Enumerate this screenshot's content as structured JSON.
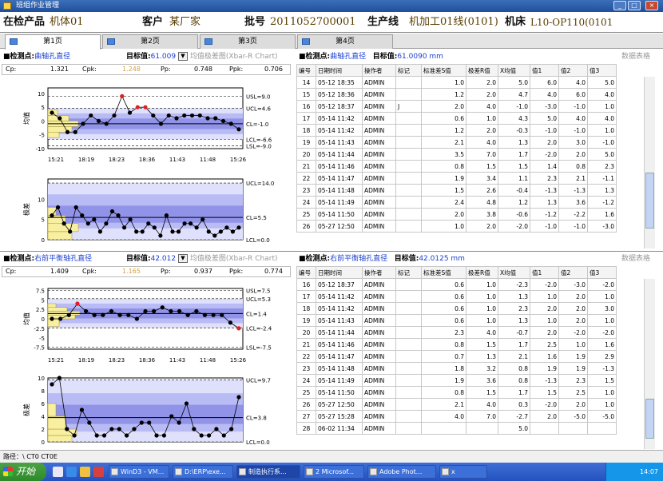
{
  "window": {
    "title": "班组作业管理"
  },
  "info": {
    "product_label": "在检产品",
    "product_value": "机体01",
    "customer_label": "客户",
    "customer_value": "某厂家",
    "batch_label": "批号",
    "batch_value": "2011052700001",
    "line_label": "生产线",
    "line_value": "机加工01线(0101)",
    "machine_label": "机床",
    "machine_value": "L10-OP110(0101"
  },
  "tabs": [
    "第1页",
    "第2页",
    "第3页",
    "第4页"
  ],
  "panel1": {
    "point_label": "■检测点:",
    "point_name": "曲轴孔直径",
    "target_label": "目标值:",
    "target_value": "61.009",
    "chart_sel": "均值极差图(Xbar-R Chart)",
    "right_point_name": "曲轴孔直径",
    "right_target": "61.0090 mm",
    "link": "数据表格",
    "cap": {
      "cp_label": "Cp:",
      "cp": "1.321",
      "cpk_label": "Cpk:",
      "cpk": "1.248",
      "pp_label": "Pp:",
      "pp": "0.748",
      "ppk_label": "Ppk:",
      "ppk": "0.706"
    },
    "xbar_ylabel": "均值",
    "r_ylabel": "极差",
    "xbar_labels": [
      "USL=9.0",
      "UCL=4.6",
      "CL=-1.0",
      "LCL=-6.6",
      "LSL=-9.0"
    ],
    "r_labels": [
      "UCL=14.0",
      "CL=5.5",
      "LCL=0.0"
    ],
    "xticks": [
      "15:21",
      "18:19",
      "18:23",
      "18:36",
      "11:43",
      "11:48",
      "15:26"
    ],
    "xbar_yticks": [
      "10",
      "5",
      "0",
      "-5",
      "-10"
    ],
    "r_yticks": [
      "10",
      "5",
      "0"
    ]
  },
  "panel2": {
    "point_label": "■检测点:",
    "point_name": "右前平衡轴孔直径",
    "target_label": "目标值:",
    "target_value": "42.012",
    "chart_sel": "均值极差图(Xbar-R Chart)",
    "right_point_name": "右前平衡轴孔直径",
    "right_target": "42.0125 mm",
    "link": "数据表格",
    "cap": {
      "cp_label": "Cp:",
      "cp": "1.409",
      "cpk_label": "Cpk:",
      "cpk": "1.165",
      "pp_label": "Pp:",
      "pp": "0.937",
      "ppk_label": "Ppk:",
      "ppk": "0.774"
    },
    "xbar_ylabel": "均值",
    "r_ylabel": "极差",
    "xbar_labels": [
      "USL=7.5",
      "UCL=5.3",
      "CL=1.4",
      "LCL=-2.4",
      "LSL=-7.5"
    ],
    "r_labels": [
      "UCL=9.7",
      "CL=3.8",
      "LCL=0.0"
    ],
    "xticks": [
      "15:21",
      "18:19",
      "18:23",
      "18:36",
      "11:43",
      "11:48",
      "15:26"
    ],
    "xbar_yticks": [
      "7.5",
      "5",
      "2.5",
      "0",
      "-2.5",
      "-5",
      "-7.5"
    ],
    "r_yticks": [
      "10",
      "8",
      "6",
      "4",
      "2",
      "0"
    ]
  },
  "table_headers": [
    "编号",
    "日期时间",
    "操作者",
    "标记",
    "标准差S值",
    "极差R值",
    "X均值",
    "值1",
    "值2",
    "值3"
  ],
  "table1": [
    [
      "14",
      "05-12 18:35",
      "ADMIN",
      "",
      "1.0",
      "2.0",
      "5.0",
      "6.0",
      "4.0",
      "5.0"
    ],
    [
      "15",
      "05-12 18:36",
      "ADMIN",
      "",
      "1.2",
      "2.0",
      "4.7",
      "4.0",
      "6.0",
      "4.0"
    ],
    [
      "16",
      "05-12 18:37",
      "ADMIN",
      "J",
      "2.0",
      "4.0",
      "-1.0",
      "-3.0",
      "-1.0",
      "1.0"
    ],
    [
      "17",
      "05-14 11:42",
      "ADMIN",
      "",
      "0.6",
      "1.0",
      "4.3",
      "5.0",
      "4.0",
      "4.0"
    ],
    [
      "18",
      "05-14 11:42",
      "ADMIN",
      "",
      "1.2",
      "2.0",
      "-0.3",
      "-1.0",
      "-1.0",
      "1.0"
    ],
    [
      "19",
      "05-14 11:43",
      "ADMIN",
      "",
      "2.1",
      "4.0",
      "1.3",
      "2.0",
      "3.0",
      "-1.0"
    ],
    [
      "20",
      "05-14 11:44",
      "ADMIN",
      "",
      "3.5",
      "7.0",
      "1.7",
      "-2.0",
      "2.0",
      "5.0"
    ],
    [
      "21",
      "05-14 11:46",
      "ADMIN",
      "",
      "0.8",
      "1.5",
      "1.5",
      "1.4",
      "0.8",
      "2.3"
    ],
    [
      "22",
      "05-14 11:47",
      "ADMIN",
      "",
      "1.9",
      "3.4",
      "1.1",
      "2.3",
      "2.1",
      "-1.1"
    ],
    [
      "23",
      "05-14 11:48",
      "ADMIN",
      "",
      "1.5",
      "2.6",
      "-0.4",
      "-1.3",
      "-1.3",
      "1.3"
    ],
    [
      "24",
      "05-14 11:49",
      "ADMIN",
      "",
      "2.4",
      "4.8",
      "1.2",
      "1.3",
      "3.6",
      "-1.2"
    ],
    [
      "25",
      "05-14 11:50",
      "ADMIN",
      "",
      "2.0",
      "3.8",
      "-0.6",
      "-1.2",
      "-2.2",
      "1.6"
    ],
    [
      "26",
      "05-27 12:50",
      "ADMIN",
      "",
      "1.0",
      "2.0",
      "-2.0",
      "-1.0",
      "-1.0",
      "-3.0"
    ]
  ],
  "table2": [
    [
      "16",
      "05-12 18:37",
      "ADMIN",
      "",
      "0.6",
      "1.0",
      "-2.3",
      "-2.0",
      "-3.0",
      "-2.0"
    ],
    [
      "17",
      "05-14 11:42",
      "ADMIN",
      "",
      "0.6",
      "1.0",
      "1.3",
      "1.0",
      "2.0",
      "1.0"
    ],
    [
      "18",
      "05-14 11:42",
      "ADMIN",
      "",
      "0.6",
      "1.0",
      "2.3",
      "2.0",
      "2.0",
      "3.0"
    ],
    [
      "19",
      "05-14 11:43",
      "ADMIN",
      "",
      "0.6",
      "1.0",
      "1.3",
      "1.0",
      "2.0",
      "1.0"
    ],
    [
      "20",
      "05-14 11:44",
      "ADMIN",
      "",
      "2.3",
      "4.0",
      "-0.7",
      "2.0",
      "-2.0",
      "-2.0"
    ],
    [
      "21",
      "05-14 11:46",
      "ADMIN",
      "",
      "0.8",
      "1.5",
      "1.7",
      "2.5",
      "1.0",
      "1.6"
    ],
    [
      "22",
      "05-14 11:47",
      "ADMIN",
      "",
      "0.7",
      "1.3",
      "2.1",
      "1.6",
      "1.9",
      "2.9"
    ],
    [
      "23",
      "05-14 11:48",
      "ADMIN",
      "",
      "1.8",
      "3.2",
      "0.8",
      "1.9",
      "1.9",
      "-1.3"
    ],
    [
      "24",
      "05-14 11:49",
      "ADMIN",
      "",
      "1.9",
      "3.6",
      "0.8",
      "-1.3",
      "2.3",
      "1.5"
    ],
    [
      "25",
      "05-14 11:50",
      "ADMIN",
      "",
      "0.8",
      "1.5",
      "1.7",
      "1.5",
      "2.5",
      "1.0"
    ],
    [
      "26",
      "05-27 12:50",
      "ADMIN",
      "",
      "2.1",
      "4.0",
      "0.3",
      "-2.0",
      "2.0",
      "1.0"
    ],
    [
      "27",
      "05-27 15:28",
      "ADMIN",
      "",
      "4.0",
      "7.0",
      "-2.7",
      "2.0",
      "-5.0",
      "-5.0"
    ],
    [
      "28",
      "06-02 11:34",
      "ADMIN",
      "",
      "",
      "",
      "5.0",
      "",
      "",
      ""
    ]
  ],
  "status": {
    "path": "路径：\\ CT0 CT0E"
  },
  "taskbar": {
    "start": "开始",
    "tasks": [
      "WinD3 - VM...",
      "D:\\ERP\\exe...",
      "制造执行系...",
      "2 Microsof...",
      "Adobe Phot...",
      "x"
    ],
    "time": "14:07"
  },
  "chart_data": [
    {
      "type": "line",
      "title": "",
      "xlabel": "",
      "ylabel": "均值",
      "ylim": [
        -10,
        12
      ],
      "series": [
        {
          "values": [
            3,
            1,
            -4,
            -4,
            -1,
            2,
            0,
            -1,
            2,
            9,
            3,
            5,
            5,
            2,
            -1,
            2,
            1,
            2,
            2,
            2,
            1,
            1,
            0,
            -1,
            -3
          ]
        }
      ]
    },
    {
      "type": "line",
      "title": "",
      "xlabel": "",
      "ylabel": "极差",
      "ylim": [
        0,
        15
      ],
      "series": [
        {
          "values": [
            6,
            8,
            4,
            2,
            8,
            6,
            4,
            5,
            2,
            4,
            7,
            6,
            3,
            5,
            2,
            2,
            4,
            3,
            1,
            6,
            2,
            2,
            4,
            4,
            3,
            5,
            2,
            1,
            2,
            3,
            2,
            3
          ]
        }
      ]
    },
    {
      "type": "line",
      "title": "",
      "xlabel": "",
      "ylabel": "均值",
      "ylim": [
        -8,
        8
      ],
      "series": [
        {
          "values": [
            0,
            0,
            1,
            4,
            2,
            1,
            1,
            2,
            1,
            1,
            0,
            2,
            2,
            3,
            2,
            2,
            1,
            2,
            1,
            1,
            1,
            -1,
            -2.5
          ]
        }
      ]
    },
    {
      "type": "line",
      "title": "",
      "xlabel": "",
      "ylabel": "极差",
      "ylim": [
        0,
        10
      ],
      "series": [
        {
          "values": [
            9,
            10,
            2,
            1,
            5,
            3,
            1,
            1,
            2,
            2,
            1,
            2,
            3,
            3,
            1,
            1,
            4,
            3,
            6,
            2,
            1,
            1,
            2,
            1,
            2,
            7
          ]
        }
      ]
    }
  ]
}
